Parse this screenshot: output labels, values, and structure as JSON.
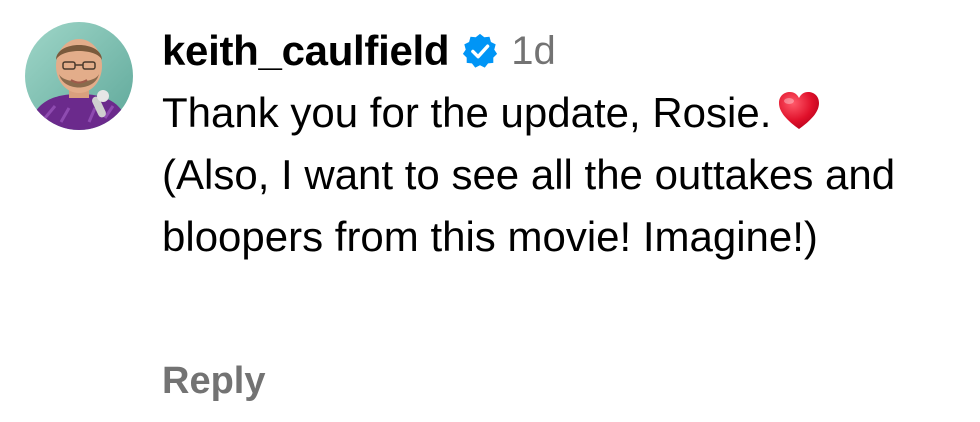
{
  "comment": {
    "username": "keith_caulfield",
    "verified_icon": "verified-badge-icon",
    "time": "1d",
    "text_line1": "Thank you for the update, Rosie.",
    "text_rest": "(Also, I want to see all the outtakes and bloopers from this movie! Imagine!)",
    "emoji": "red-heart-icon",
    "reply_label": "Reply"
  },
  "colors": {
    "verified_blue": "#0095F6",
    "meta_gray": "#737373",
    "heart_red": "#E0102A"
  }
}
